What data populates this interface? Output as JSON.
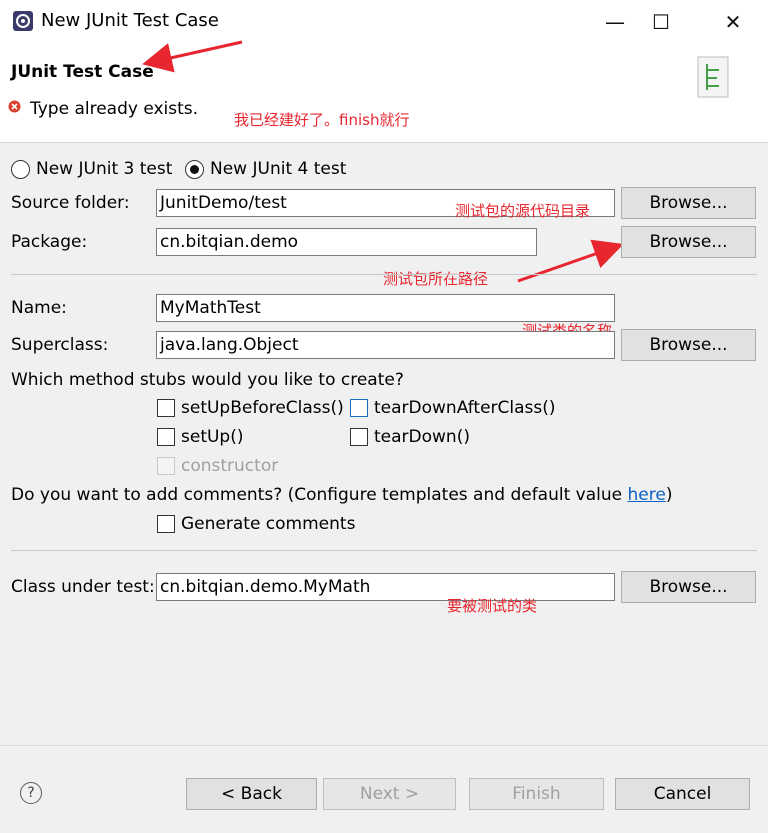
{
  "window": {
    "title": "New JUnit Test Case",
    "minimize_label": "—",
    "maximize_label": "☐",
    "close_label": "✕"
  },
  "header": {
    "title": "JUnit Test Case",
    "error_message": "Type already exists."
  },
  "annotations": {
    "finish_note": "我已经建好了。finish就行",
    "source_note": "测试包的源代码目录",
    "package_note": "测试包所在路径",
    "name_note": "测试类的名称",
    "class_note": "要被测试的类"
  },
  "form": {
    "radio_junit3": "New JUnit 3 test",
    "radio_junit4": "New JUnit 4 test",
    "source_folder_label": "Source folder:",
    "source_folder_value": "JunitDemo/test",
    "package_label": "Package:",
    "package_value": "cn.bitqian.demo",
    "name_label": "Name:",
    "name_value": "MyMathTest",
    "superclass_label": "Superclass:",
    "superclass_value": "java.lang.Object",
    "browse_label": "Browse...",
    "stubs_question": "Which method stubs would you like to create?",
    "stubs": {
      "setUpBeforeClass": "setUpBeforeClass()",
      "tearDownAfterClass": "tearDownAfterClass()",
      "setUp": "setUp()",
      "tearDown": "tearDown()",
      "constructor": "constructor"
    },
    "comments_question": "Do you want to add comments? (Configure templates and default value ",
    "comments_link": "here",
    "comments_close": ")",
    "generate_comments": "Generate comments",
    "class_under_test_label": "Class under test:",
    "class_under_test_value": "cn.bitqian.demo.MyMath"
  },
  "footer": {
    "help": "?",
    "back": "< Back",
    "next": "Next >",
    "finish": "Finish",
    "cancel": "Cancel"
  },
  "colors": {
    "annotation_red": "#e8262f",
    "link_blue": "#0b62c4"
  }
}
